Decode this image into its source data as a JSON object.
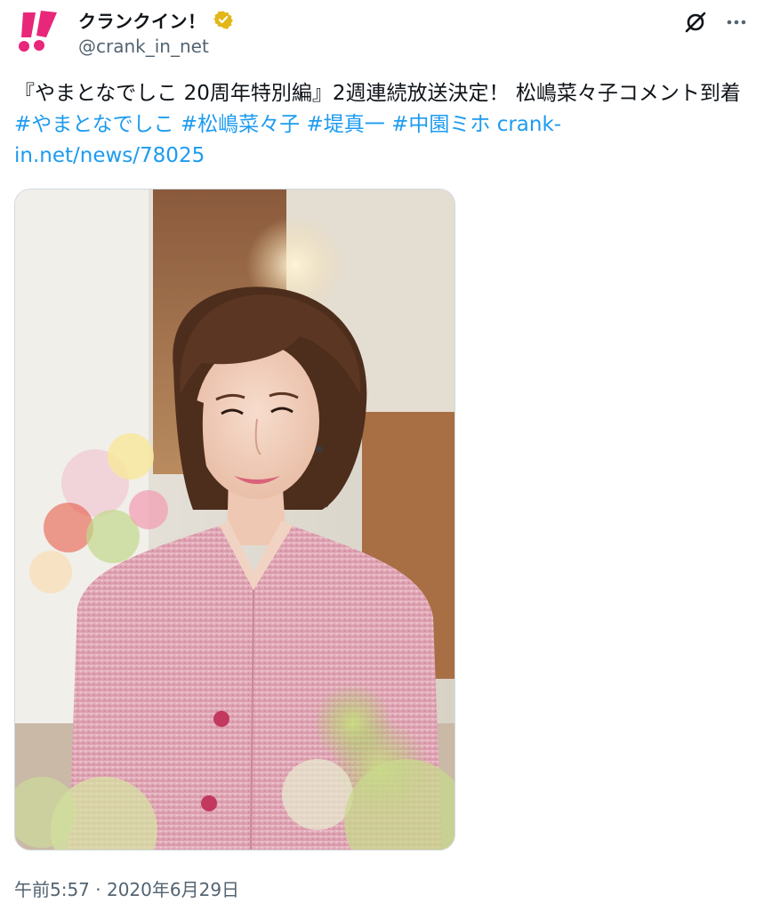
{
  "author": {
    "display_name": "クランクイン！",
    "handle": "@crank_in_net",
    "verified": true,
    "avatar_icon": "crank-in-logo-icon",
    "brand_color": "#e8267a",
    "verified_color": "#e2b719"
  },
  "actions": {
    "grok_icon": "grok-icon",
    "more_icon": "more-options-icon"
  },
  "tweet": {
    "text_prefix": "『やまとなでしこ 20周年特別編』2週連続放送決定！ 松嶋菜々子コメント到着 ",
    "hashtags": [
      "#やまとなでしこ",
      "#松嶋菜々子",
      "#堤真一",
      "#中園ミホ"
    ],
    "link": "crank-in.net/news/78025",
    "link_color": "#1d9bf0"
  },
  "media": {
    "type": "photo",
    "subject": "woman-in-pink-tweed-jacket"
  },
  "timestamp": "午前5:57 · 2020年6月29日"
}
